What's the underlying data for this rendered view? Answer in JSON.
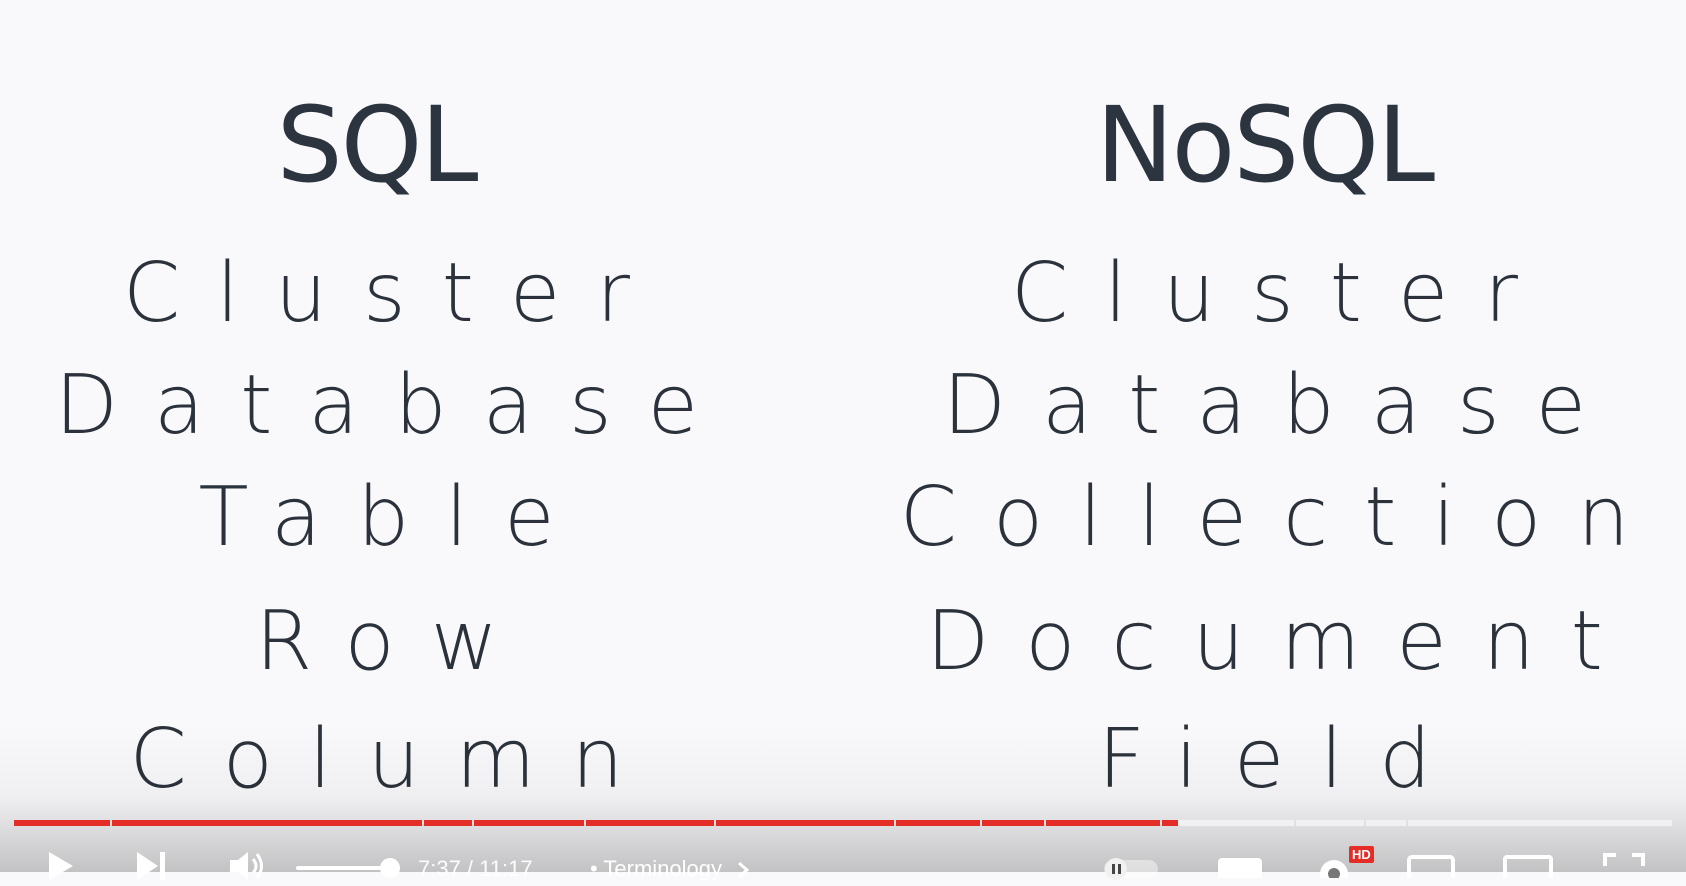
{
  "slide": {
    "left": {
      "heading": "SQL",
      "terms": [
        "Cluster",
        "Database",
        "Table",
        "Row",
        "Column"
      ]
    },
    "right": {
      "heading": "NoSQL",
      "terms": [
        "Cluster",
        "Database",
        "Collection",
        "Document",
        "Field"
      ]
    }
  },
  "player": {
    "time": "7:37 / 11:17",
    "chapter": "• Terminology",
    "quality_badge": "HD",
    "progress_fraction": 0.675,
    "volume_fraction": 0.85,
    "colors": {
      "played": "#e52d27",
      "text": "#2b323b",
      "background": "#f9f9fb"
    },
    "icons": [
      "play-icon",
      "next-icon",
      "volume-icon",
      "chevron-right-icon",
      "autoplay-toggle-icon",
      "subtitles-icon",
      "settings-icon",
      "miniplayer-icon",
      "theater-icon",
      "fullscreen-icon"
    ]
  }
}
